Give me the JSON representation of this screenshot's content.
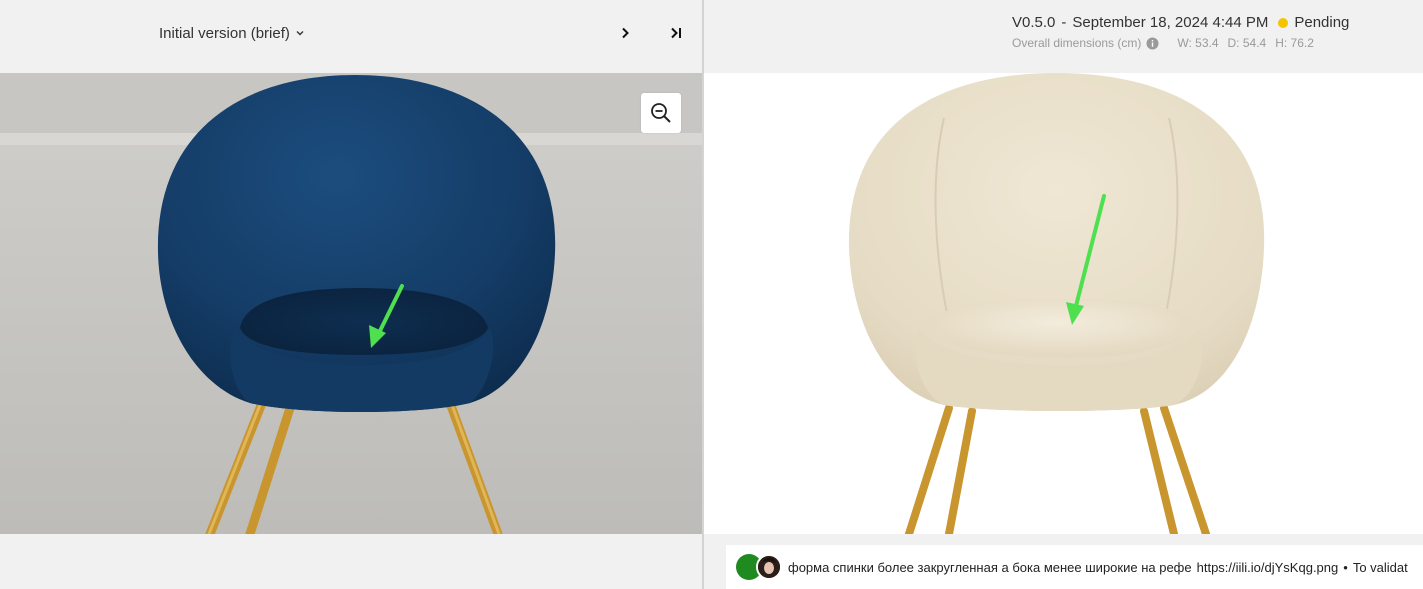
{
  "left": {
    "version_label": "Initial version (brief)",
    "icons": {
      "version_caret": "chevron-down-icon",
      "next": "chevron-right-icon",
      "last": "skip-to-end-icon",
      "zoom": "zoom-out-icon"
    },
    "photo": {
      "chair_color": "#123a63",
      "leg_color": "#c8952e",
      "background": "#c9c8c4"
    }
  },
  "right": {
    "version": "V0.5.0",
    "separator": "-",
    "date": "September 18, 2024 4:44 PM",
    "status": "Pending",
    "status_color": "#f5c400",
    "dimensions_label": "Overall dimensions (cm)",
    "info_icon": "info-icon",
    "dims": {
      "w": "W: 53.4",
      "d": "D: 54.4",
      "h": "H: 76.2"
    },
    "render": {
      "chair_color": "#e8dfca",
      "leg_color": "#c8952e",
      "background": "#ffffff"
    }
  },
  "annotation_arrow_color": "#4ee04e",
  "comment": {
    "text": "форма спинки более закругленная а бока менее широкие на рефе",
    "link": "https://iili.io/djYsKqg.png",
    "separator": "•",
    "action": "To validat"
  }
}
